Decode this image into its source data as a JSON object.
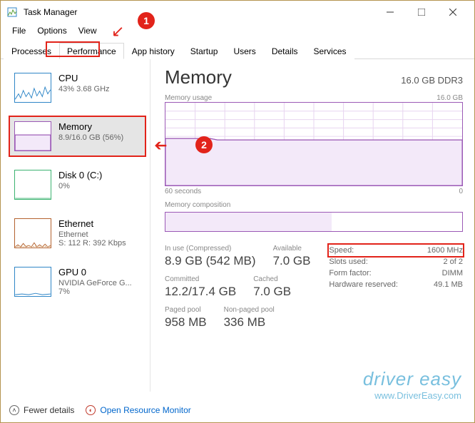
{
  "window": {
    "title": "Task Manager"
  },
  "menu": {
    "file": "File",
    "options": "Options",
    "view": "View"
  },
  "tabs": [
    "Processes",
    "Performance",
    "App history",
    "Startup",
    "Users",
    "Details",
    "Services"
  ],
  "sidebar": [
    {
      "name": "CPU",
      "detail": "43% 3.68 GHz",
      "color": "#2f86c7"
    },
    {
      "name": "Memory",
      "detail": "8.9/16.0 GB (56%)",
      "color": "#9b59b6"
    },
    {
      "name": "Disk 0 (C:)",
      "detail": "0%",
      "color": "#3cb371"
    },
    {
      "name": "Ethernet",
      "detail1": "Ethernet",
      "detail2": "S: 112 R: 392 Kbps",
      "color": "#b4622f"
    },
    {
      "name": "GPU 0",
      "detail1": "NVIDIA GeForce G...",
      "detail2": "7%",
      "color": "#2f86c7"
    }
  ],
  "main": {
    "title": "Memory",
    "subtitle": "16.0 GB DDR3",
    "chart_top_label": "Memory usage",
    "chart_top_right": "16.0 GB",
    "chart_bottom_left": "60 seconds",
    "chart_bottom_right": "0",
    "composition_label": "Memory composition"
  },
  "stats_left": {
    "in_use_label": "In use (Compressed)",
    "in_use": "8.9 GB (542 MB)",
    "available_label": "Available",
    "available": "7.0 GB",
    "committed_label": "Committed",
    "committed": "12.2/17.4 GB",
    "cached_label": "Cached",
    "cached": "7.0 GB",
    "paged_label": "Paged pool",
    "paged": "958 MB",
    "nonpaged_label": "Non-paged pool",
    "nonpaged": "336 MB"
  },
  "stats_right": {
    "speed_label": "Speed:",
    "speed": "1600 MHz",
    "slots_label": "Slots used:",
    "slots": "2 of 2",
    "form_label": "Form factor:",
    "form": "DIMM",
    "reserved_label": "Hardware reserved:",
    "reserved": "49.1 MB"
  },
  "footer": {
    "fewer": "Fewer details",
    "orm": "Open Resource Monitor"
  },
  "watermark": {
    "brand": "driver easy",
    "url": "www.DriverEasy.com"
  },
  "chart_data": {
    "type": "line",
    "title": "Memory usage",
    "xlabel": "60 seconds",
    "ylabel": "",
    "ylim": [
      0,
      16
    ],
    "x": [
      0,
      5,
      10,
      15,
      20,
      25,
      30,
      35,
      40,
      45,
      50,
      55,
      60
    ],
    "series": [
      {
        "name": "Memory",
        "values": [
          9.0,
          9.0,
          9.0,
          8.9,
          8.9,
          8.9,
          8.9,
          8.9,
          8.9,
          8.9,
          8.9,
          8.9,
          8.9
        ]
      }
    ]
  }
}
